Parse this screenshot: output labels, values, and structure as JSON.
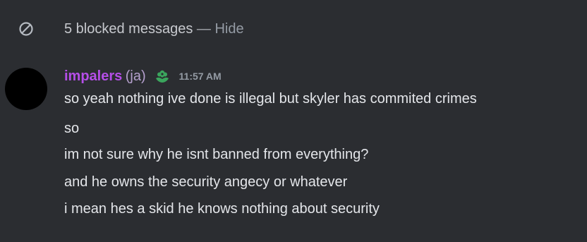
{
  "blocked_notice": {
    "icon": "blocked-icon",
    "text": "5 blocked messages",
    "separator": "—",
    "hide_label": "Hide"
  },
  "message": {
    "avatar_color": "#000000",
    "username": "impalers",
    "username_color": "#b54ee8",
    "pronoun": "(ja)",
    "badge_icon": "flower-badge-icon",
    "badge_color": "#3ba55d",
    "timestamp": "11:57 AM",
    "lines": [
      "so yeah nothing ive done is illegal but skyler has commited crimes",
      "so",
      "im not sure why he isnt banned from everything?",
      "and he owns the security angecy or whatever",
      "i mean hes a skid he knows nothing about security"
    ]
  }
}
